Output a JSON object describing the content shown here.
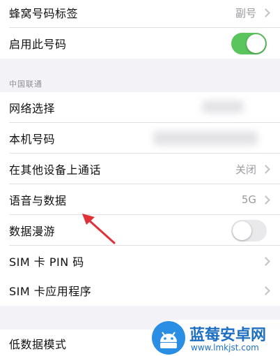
{
  "top_group": {
    "cellular_label_row": {
      "label": "蜂窝号码标签",
      "value": "副号"
    },
    "enable_line_row": {
      "label": "启用此号码",
      "toggle": "on"
    }
  },
  "carrier_section": {
    "header": "中国联通",
    "rows": [
      {
        "label": "网络选择"
      },
      {
        "label": "本机号码"
      },
      {
        "label": "在其他设备上通话",
        "value": "关闭"
      },
      {
        "label": "语音与数据",
        "value": "5G"
      },
      {
        "label": "数据漫游",
        "toggle": "off"
      },
      {
        "label": "SIM 卡 PIN 码"
      },
      {
        "label": "SIM 卡应用程序"
      }
    ]
  },
  "bottom_group": {
    "low_data_row": {
      "label": "低数据模式"
    }
  },
  "watermark": {
    "title": "蓝莓安卓网",
    "url": "www.lmkjst.com"
  },
  "colors": {
    "toggle_on": "#5ac45d",
    "toggle_off": "#e9e9eb",
    "annotation_arrow": "#e0313a",
    "watermark_blue": "#1e6fc2"
  }
}
